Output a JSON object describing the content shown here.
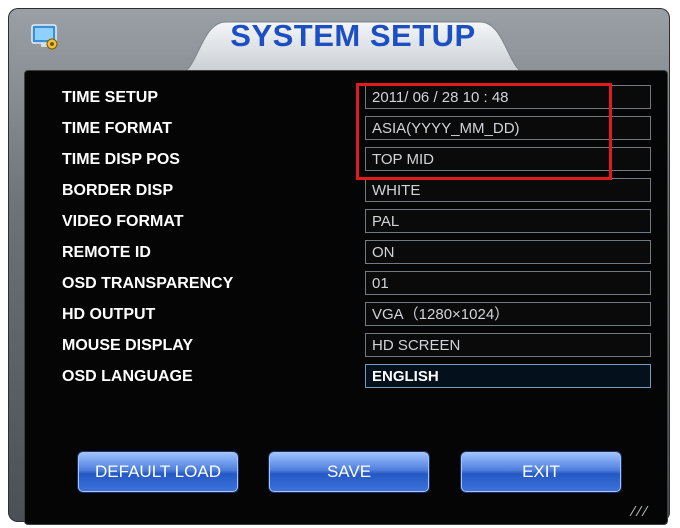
{
  "title": "SYSTEM SETUP",
  "settings": [
    {
      "label": "TIME SETUP",
      "value": "2011/ 06 / 28   10 : 48"
    },
    {
      "label": "TIME FORMAT",
      "value": "ASIA(YYYY_MM_DD)"
    },
    {
      "label": "TIME DISP POS",
      "value": "TOP MID"
    },
    {
      "label": "BORDER DISP",
      "value": "WHITE"
    },
    {
      "label": "VIDEO FORMAT",
      "value": "PAL"
    },
    {
      "label": "REMOTE ID",
      "value": "ON"
    },
    {
      "label": "OSD  TRANSPARENCY",
      "value": "01"
    },
    {
      "label": "HD OUTPUT",
      "value": "VGA（1280×1024）"
    },
    {
      "label": "MOUSE DISPLAY",
      "value": "HD SCREEN"
    },
    {
      "label": "OSD LANGUAGE",
      "value": "ENGLISH"
    }
  ],
  "buttons": {
    "default_load": "DEFAULT LOAD",
    "save": "SAVE",
    "exit": "EXIT"
  },
  "icons": {
    "app": "monitor-gear-icon",
    "grip": "resize-grip-icon"
  },
  "colors": {
    "title": "#1c4fc4",
    "highlight": "#e11b1b",
    "button": "#3d72dc"
  }
}
